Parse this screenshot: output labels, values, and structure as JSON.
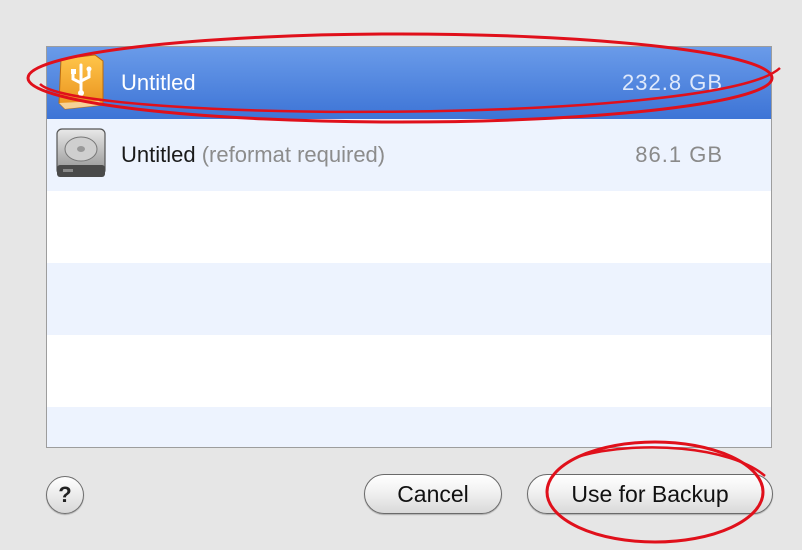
{
  "disks": [
    {
      "name": "Untitled",
      "hint": "",
      "size": "232.8 GB",
      "icon": "usb-drive-icon",
      "selected": true
    },
    {
      "name": "Untitled",
      "hint": "(reformat required)",
      "size": "86.1 GB",
      "icon": "hard-drive-icon",
      "selected": false
    }
  ],
  "buttons": {
    "help_label": "?",
    "cancel_label": "Cancel",
    "backup_label": "Use for Backup"
  },
  "colors": {
    "selection": "#3d74d6",
    "annotation": "#e0101b",
    "usb_icon": "#f2a52b"
  }
}
